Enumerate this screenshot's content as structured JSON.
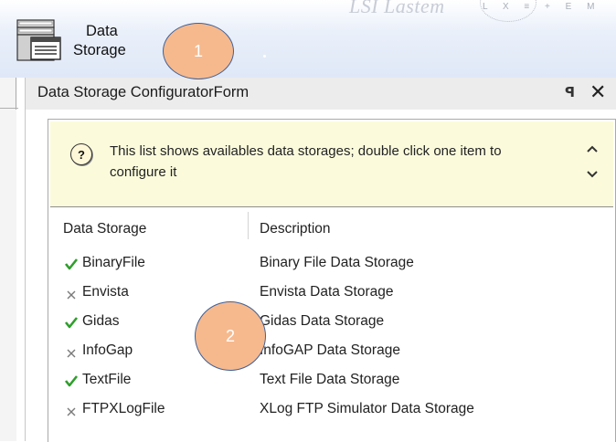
{
  "ribbon": {
    "brand_text": "LSI Lastem",
    "brand_small": "L X ≡ + E M",
    "data_storage_button": {
      "label_line1": "Data",
      "label_line2": "Storage"
    }
  },
  "callouts": [
    "1",
    "2"
  ],
  "panel": {
    "title": "Data Storage ConfiguratorForm",
    "pin_glyph": "ꟼ",
    "close_glyph": "✕",
    "info_text": "This list shows availables data storages; double click one item to configure it",
    "help_glyph": "?",
    "columns": {
      "name": "Data Storage",
      "description": "Description"
    },
    "rows": [
      {
        "name": "BinaryFile",
        "description": "Binary File Data Storage",
        "status": "enabled"
      },
      {
        "name": "Envista",
        "description": "Envista Data Storage",
        "status": "disabled"
      },
      {
        "name": "Gidas",
        "description": "Gidas Data Storage",
        "status": "enabled"
      },
      {
        "name": "InfoGap",
        "description": "InfoGAP Data Storage",
        "status": "disabled"
      },
      {
        "name": "TextFile",
        "description": "Text File Data Storage",
        "status": "enabled"
      },
      {
        "name": "FTPXLogFile",
        "description": "XLog FTP Simulator Data Storage",
        "status": "disabled"
      }
    ]
  },
  "colors": {
    "check_green": "#2e9e2b",
    "cross_grey": "#7a7a7a",
    "callout_fill": "#f6b98d",
    "callout_border": "#3f6098",
    "info_background": "#fbfbdc"
  }
}
